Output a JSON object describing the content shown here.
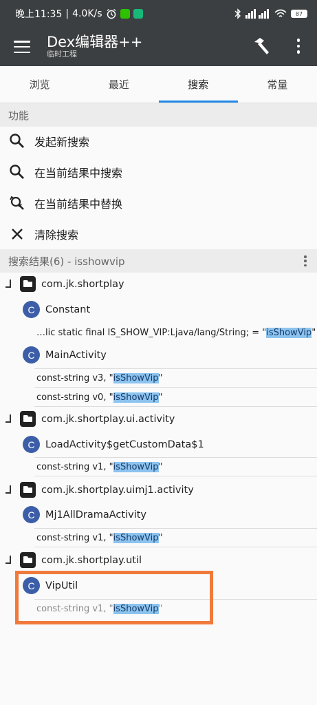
{
  "status_bar": {
    "time": "晚上11:35",
    "speed": "4.0K/s",
    "battery": "87"
  },
  "app_bar": {
    "title": "Dex编辑器++",
    "subtitle": "临时工程"
  },
  "tabs": [
    {
      "label": "浏览"
    },
    {
      "label": "最近"
    },
    {
      "label": "搜索"
    },
    {
      "label": "常量"
    }
  ],
  "functions": {
    "header": "功能",
    "items": [
      {
        "label": "发起新搜索",
        "icon": "search-icon"
      },
      {
        "label": "在当前结果中搜索",
        "icon": "search-icon"
      },
      {
        "label": "在当前结果中替换",
        "icon": "replace-icon"
      },
      {
        "label": "清除搜索",
        "icon": "close-icon"
      }
    ]
  },
  "results": {
    "header": "搜索结果(6) - isshowvip",
    "packages": [
      {
        "name": "com.jk.shortplay"
      },
      {
        "name": "com.jk.shortplay.ui.activity"
      },
      {
        "name": "com.jk.shortplay.uimj1.activity"
      },
      {
        "name": "com.jk.shortplay.util"
      }
    ],
    "classes": [
      {
        "badge": "C",
        "name": "Constant"
      },
      {
        "badge": "C",
        "name": "MainActivity"
      },
      {
        "badge": "C",
        "name": "LoadActivity$getCustomData$1"
      },
      {
        "badge": "C",
        "name": "Mj1AllDramaActivity"
      },
      {
        "badge": "C",
        "name": "VipUtil"
      }
    ],
    "matches": [
      {
        "prefix": "…lic static final IS_SHOW_VIP:Ljava/lang/String; = \"",
        "match": "isShowVip",
        "suffix": "\""
      },
      {
        "prefix": "const-string v3, \"",
        "match": "isShowVip",
        "suffix": "\""
      },
      {
        "prefix": "const-string v0, \"",
        "match": "isShowVip",
        "suffix": "\""
      },
      {
        "prefix": "const-string v1, \"",
        "match": "isShowVip",
        "suffix": "\""
      },
      {
        "prefix": "const-string v1, \"",
        "match": "isShowVip",
        "suffix": "\""
      },
      {
        "prefix": "const-string v1, \"",
        "match": "isShowVip",
        "suffix": "\""
      }
    ]
  },
  "colors": {
    "app_bar": "#3c3f41",
    "tab_indicator": "#1e88e5",
    "class_badge": "#3c5ea8",
    "match_highlight": "#8cc3ef",
    "annotation_box": "#f07a3c"
  }
}
